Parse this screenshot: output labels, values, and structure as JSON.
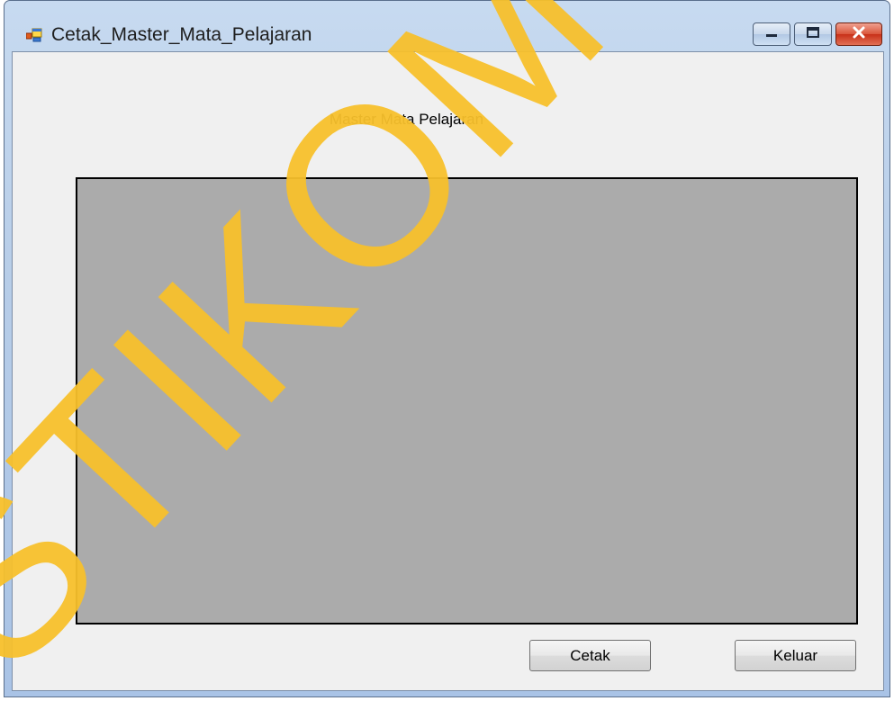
{
  "window": {
    "title": "Cetak_Master_Mata_Pelajaran",
    "icon": "windows-form-icon",
    "controls": {
      "minimize_icon": "minimize-icon",
      "maximize_icon": "maximize-icon",
      "close_icon": "close-icon"
    }
  },
  "form": {
    "heading": "Master Mata Pelajaran"
  },
  "buttons": {
    "print_label": "Cetak",
    "exit_label": "Keluar"
  },
  "watermark": {
    "text": "STIKOM SURABAYA",
    "color": "#f7c02b"
  },
  "colors": {
    "viewer_background": "#ababab",
    "form_background": "#f0f0f0",
    "close_button": "#c83018"
  }
}
